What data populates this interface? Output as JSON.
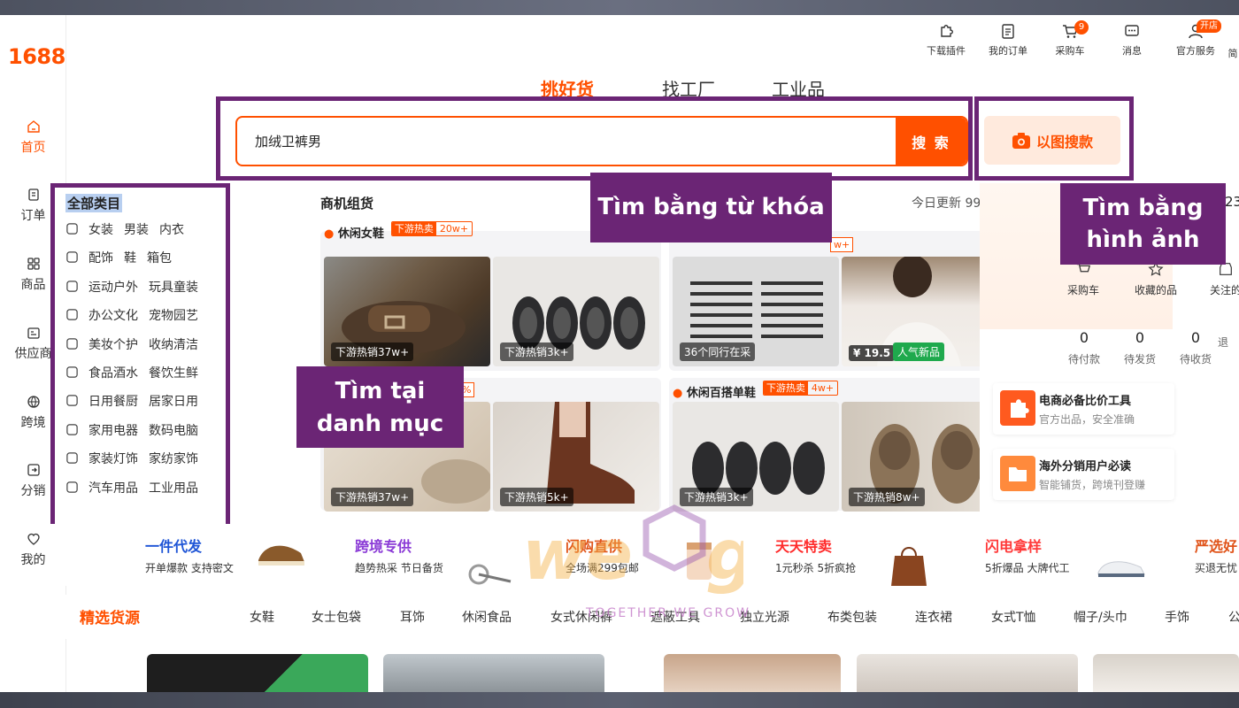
{
  "sidebar": {
    "logo": "1688",
    "items": [
      {
        "label": "首页",
        "icon": "home-icon"
      },
      {
        "label": "订单",
        "icon": "order-icon"
      },
      {
        "label": "商品",
        "icon": "grid-icon"
      },
      {
        "label": "供应商",
        "icon": "supplier-icon"
      },
      {
        "label": "跨境",
        "icon": "globe-icon"
      },
      {
        "label": "分销",
        "icon": "distribution-icon"
      },
      {
        "label": "我的",
        "icon": "user-heart-icon"
      }
    ]
  },
  "toolbar": {
    "plugin": "下载插件",
    "orders": "我的订单",
    "cart": "采购车",
    "cart_count": "9",
    "messages": "消息",
    "service": "官方服务",
    "service_badge": "开店",
    "more": "简"
  },
  "tabs": [
    "挑好货",
    "找工厂",
    "工业品"
  ],
  "search": {
    "value": "加绒卫裤男",
    "button": "搜 索",
    "image_search": "以图搜款"
  },
  "callouts": {
    "keyword": "Tìm bằng từ khóa",
    "image_1": "Tìm bằng",
    "image_2": "hình ảnh",
    "category_1": "Tìm tại",
    "category_2": "danh mục"
  },
  "categories": {
    "title": "全部类目",
    "rows": [
      [
        "女装",
        "男装",
        "内衣"
      ],
      [
        "配饰",
        "鞋",
        "箱包"
      ],
      [
        "运动户外",
        "玩具童装"
      ],
      [
        "办公文化",
        "宠物园艺"
      ],
      [
        "美妆个护",
        "收纳清洁"
      ],
      [
        "食品酒水",
        "餐饮生鲜"
      ],
      [
        "日用餐厨",
        "居家日用"
      ],
      [
        "家用电器",
        "数码电脑"
      ],
      [
        "家装灯饰",
        "家纺家饰"
      ],
      [
        "汽车用品",
        "工业用品"
      ]
    ]
  },
  "business": {
    "title": "商机组货",
    "update": "今日更新 999+",
    "card1": {
      "name": "休闲女鞋",
      "tag": "下游热卖",
      "tag_val": "20w+",
      "p1": "下游热销37w+",
      "p2": "下游热销3k+"
    },
    "card2": {
      "tag_val": "w+",
      "p1": "36个同行在采",
      "p2": "¥ 19.5",
      "p2b": "人气新品"
    },
    "card3": {
      "tag_val": "%",
      "p1": "下游热销37w+",
      "p2": "下游热销5k+"
    },
    "card4": {
      "name": "休闲百搭单鞋",
      "tag": "下游热卖",
      "tag_val": "4w+",
      "p1": "下游热销3k+",
      "p2": "下游热销8w+"
    }
  },
  "right": {
    "edge_num": "23",
    "icons": [
      "采购车",
      "收藏的品",
      "关注的"
    ],
    "counts": [
      {
        "n": "0",
        "label": "待付款"
      },
      {
        "n": "0",
        "label": "待发货"
      },
      {
        "n": "0",
        "label": "待收货"
      },
      {
        "n": "",
        "label": "退"
      }
    ],
    "tools": [
      {
        "title": "电商必备比价工具",
        "sub": "官方出品，安全准确"
      },
      {
        "title": "海外分销用户必读",
        "sub": "智能铺货，跨境刊登赚"
      }
    ]
  },
  "promos": [
    {
      "title": "一件代发",
      "sub": "开单爆款 支持密文",
      "color": "#1f55d6"
    },
    {
      "title": "跨境专供",
      "sub": "趋势热采 节日备货",
      "color": "#8a3ad6"
    },
    {
      "title": "闪购直供",
      "sub": "全场满299包邮",
      "color": "#e0541a"
    },
    {
      "title": "天天特卖",
      "sub": "1元秒杀 5折疯抢",
      "color": "#ff2a2a"
    },
    {
      "title": "闪电拿样",
      "sub": "5折爆品 大牌代工",
      "color": "#ff3a3a"
    },
    {
      "title": "严选好",
      "sub": "买退无忧",
      "color": "#e0541a"
    }
  ],
  "featured": {
    "title": "精选货源",
    "tabs": [
      "女鞋",
      "女士包袋",
      "耳饰",
      "休闲食品",
      "女式休闲裤",
      "遮蔽工具",
      "独立光源",
      "布类包装",
      "连衣裙",
      "女式T恤",
      "帽子/头巾",
      "手饰",
      "公"
    ]
  },
  "watermark": "TOGETHER WE GROW",
  "colors": {
    "accent": "#ff5000",
    "callout": "#6b2575"
  }
}
